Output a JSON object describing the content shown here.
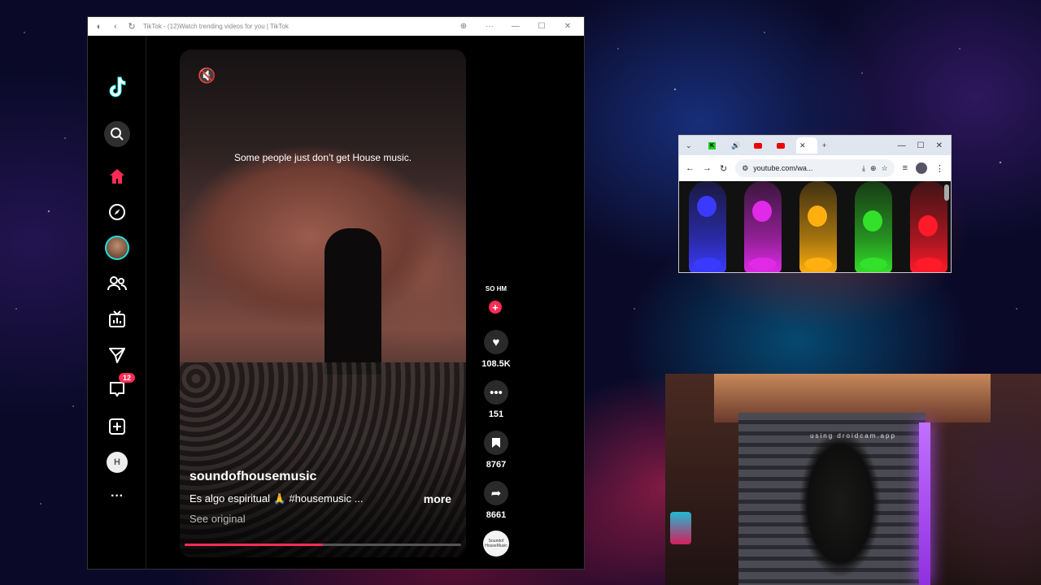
{
  "tiktok_window": {
    "title": "TikTok - (12)Watch trending videos for you | TikTok",
    "sidebar": {
      "logo": "tiktok-logo-icon",
      "items": [
        {
          "name": "search",
          "icon": "search-icon"
        },
        {
          "name": "home",
          "icon": "home-icon"
        },
        {
          "name": "explore",
          "icon": "compass-icon"
        },
        {
          "name": "profile",
          "icon": "avatar"
        },
        {
          "name": "following",
          "icon": "friends-icon"
        },
        {
          "name": "live",
          "icon": "tv-icon"
        },
        {
          "name": "messages",
          "icon": "send-icon"
        },
        {
          "name": "inbox",
          "icon": "inbox-icon",
          "badge": "12"
        },
        {
          "name": "upload",
          "icon": "plus-square-icon"
        },
        {
          "name": "account",
          "icon": "avatar"
        },
        {
          "name": "more",
          "icon": "more-icon",
          "label": "···"
        }
      ]
    },
    "video": {
      "mute_icon": "🔇",
      "overlay_text": "Some people just don’t get House music.",
      "author": "soundofhousemusic",
      "caption": "Es algo espiritual 🙏 #housemusic ...",
      "more_label": "more",
      "see_original": "See original",
      "progress": 0.5
    },
    "actions": {
      "creator_avatar_text": "SO HM",
      "follow_label": "+",
      "likes": "108.5K",
      "comments": "151",
      "saves": "8767",
      "shares": "8661",
      "disc_text": "Soundof HouseMusic"
    },
    "accent_color": "#fe2c55"
  },
  "chrome_window": {
    "url": "youtube.com/wa...",
    "new_tab_label": "+",
    "lamp_colors": [
      "#3a3aff",
      "#e02ae8",
      "#ffb010",
      "#33e02a",
      "#ff1a2a"
    ]
  },
  "webcam": {
    "watermark": "using droidcam.app"
  }
}
